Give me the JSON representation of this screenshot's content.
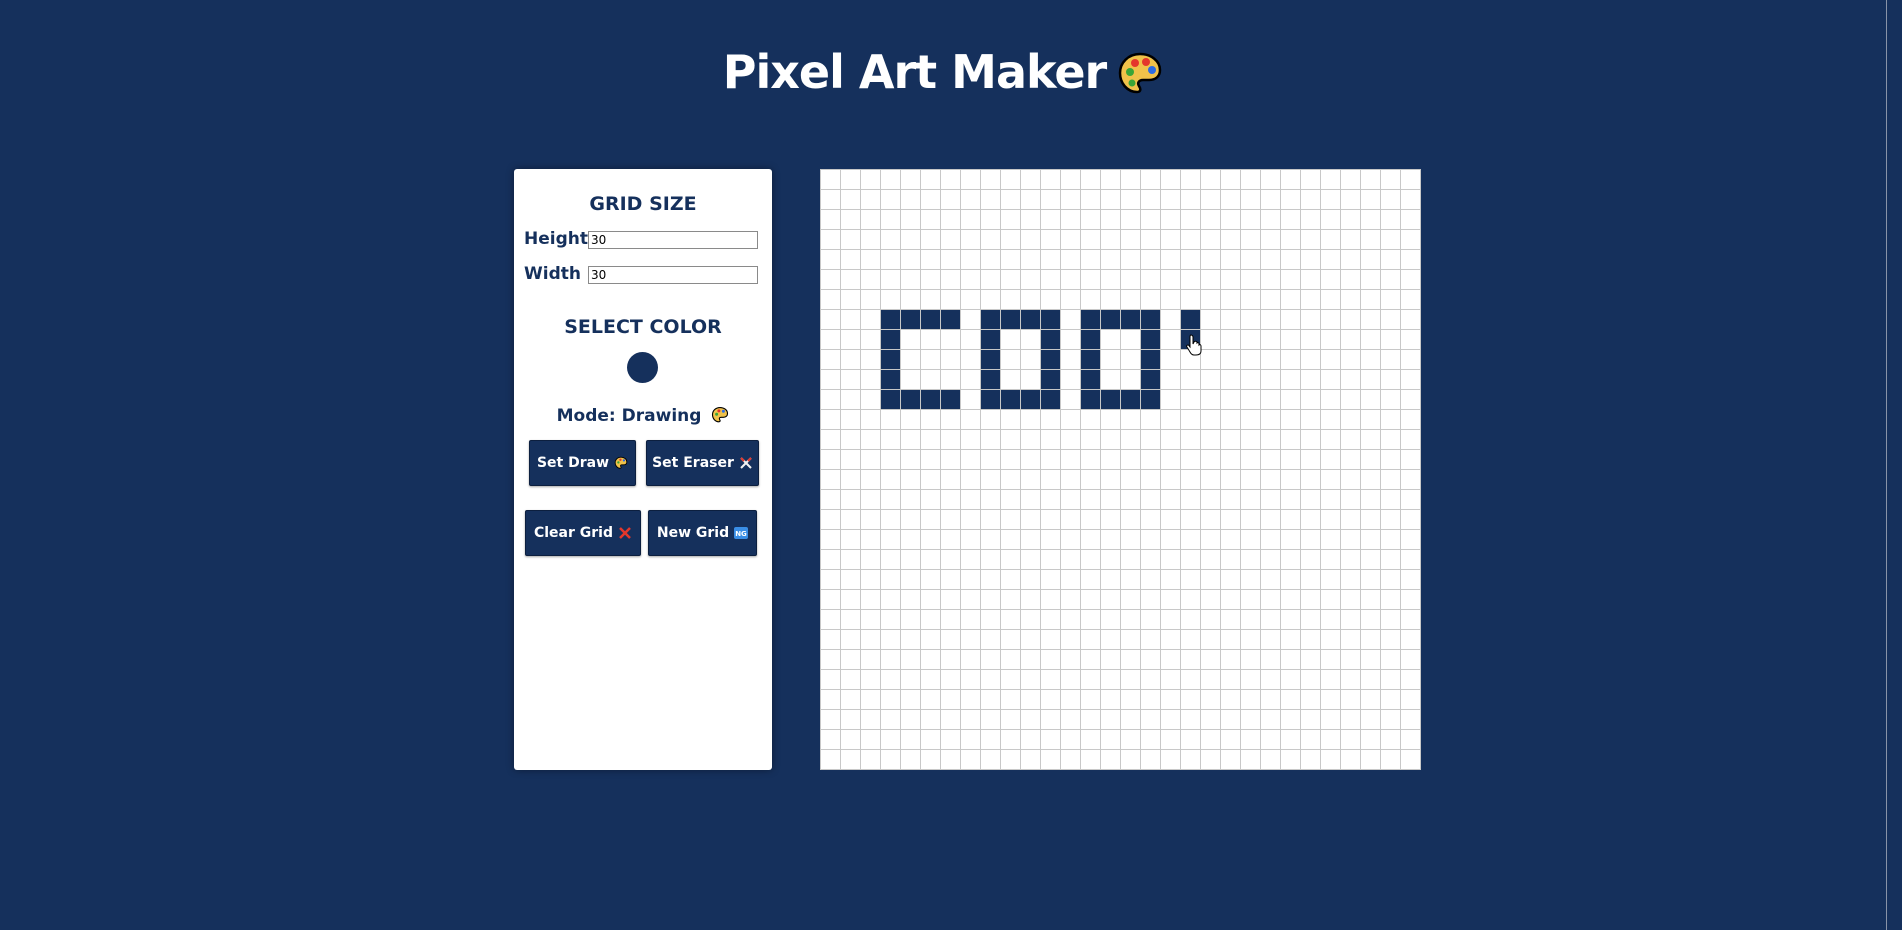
{
  "app": {
    "title": "Pixel Art Maker",
    "title_icon": "palette-icon"
  },
  "sidebar": {
    "grid_size_heading": "GRID SIZE",
    "height_label": "Height",
    "height_value": "30",
    "width_label": "Width",
    "width_value": "30",
    "select_color_heading": "SELECT COLOR",
    "selected_color": "#15305c",
    "mode_label": "Mode: Drawing",
    "mode_icon": "palette-icon",
    "buttons": {
      "set_draw": {
        "label": "Set Draw",
        "icon": "palette-icon"
      },
      "set_eraser": {
        "label": "Set Eraser",
        "icon": "eraser-icon"
      },
      "clear_grid": {
        "label": "Clear Grid",
        "icon": "cross-mark-icon"
      },
      "new_grid": {
        "label": "New Grid",
        "icon": "ng-icon"
      }
    }
  },
  "grid": {
    "rows": 30,
    "cols": 30,
    "fill_color": "#15305c",
    "line_color": "#c8c8c8",
    "filled_cells": [
      [
        7,
        3
      ],
      [
        7,
        4
      ],
      [
        7,
        5
      ],
      [
        7,
        6
      ],
      [
        7,
        8
      ],
      [
        7,
        9
      ],
      [
        7,
        10
      ],
      [
        7,
        11
      ],
      [
        7,
        13
      ],
      [
        7,
        14
      ],
      [
        7,
        15
      ],
      [
        7,
        16
      ],
      [
        7,
        18
      ],
      [
        8,
        3
      ],
      [
        8,
        8
      ],
      [
        8,
        11
      ],
      [
        8,
        13
      ],
      [
        8,
        16
      ],
      [
        8,
        18
      ],
      [
        9,
        3
      ],
      [
        9,
        8
      ],
      [
        9,
        11
      ],
      [
        9,
        13
      ],
      [
        9,
        16
      ],
      [
        10,
        3
      ],
      [
        10,
        8
      ],
      [
        10,
        11
      ],
      [
        10,
        13
      ],
      [
        10,
        16
      ],
      [
        11,
        3
      ],
      [
        11,
        4
      ],
      [
        11,
        5
      ],
      [
        11,
        6
      ],
      [
        11,
        8
      ],
      [
        11,
        9
      ],
      [
        11,
        10
      ],
      [
        11,
        11
      ],
      [
        11,
        13
      ],
      [
        11,
        14
      ],
      [
        11,
        15
      ],
      [
        11,
        16
      ]
    ]
  },
  "colors": {
    "background": "#15305c",
    "panel": "#ffffff",
    "accent": "#15305c"
  }
}
